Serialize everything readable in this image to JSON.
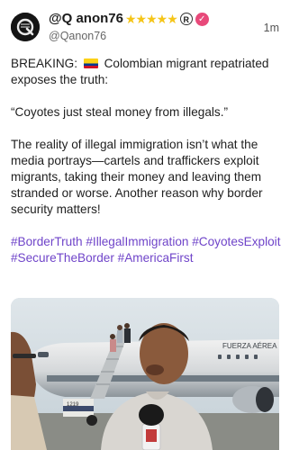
{
  "post": {
    "display_name": "@Q anon76",
    "stars": "★★★★★",
    "registered_mark": "R",
    "verified_mark": "✓",
    "handle": "@Qanon76",
    "timestamp": "1m",
    "body": {
      "line1_prefix": "BREAKING:",
      "line1_suffix": "Colombian migrant repatriated exposes the truth:",
      "quote": "“Coyotes just steal money from illegals.”",
      "paragraph": "The reality of illegal immigration isn’t what the media portrays—cartels and traffickers exploit migrants, taking their money and leaving them stranded or worse. Another reason why border security matters!"
    },
    "hashtags": [
      "#BorderTruth",
      "#IllegalImmigration",
      "#CoyotesExploit",
      "#SecureTheBorder",
      "#AmericaFirst"
    ],
    "media": {
      "plane_text": "FUERZA AÉREA",
      "tail_number": "1219"
    }
  },
  "colors": {
    "hashtag": "#6f44c9",
    "stars": "#f5c518",
    "verified_badge": "#e8497a",
    "flag": [
      "#fcd116",
      "#003893",
      "#ce1126"
    ]
  },
  "icons": [
    "avatar-q-logo",
    "flag-colombia-icon",
    "verified-badge-icon",
    "registered-icon"
  ]
}
